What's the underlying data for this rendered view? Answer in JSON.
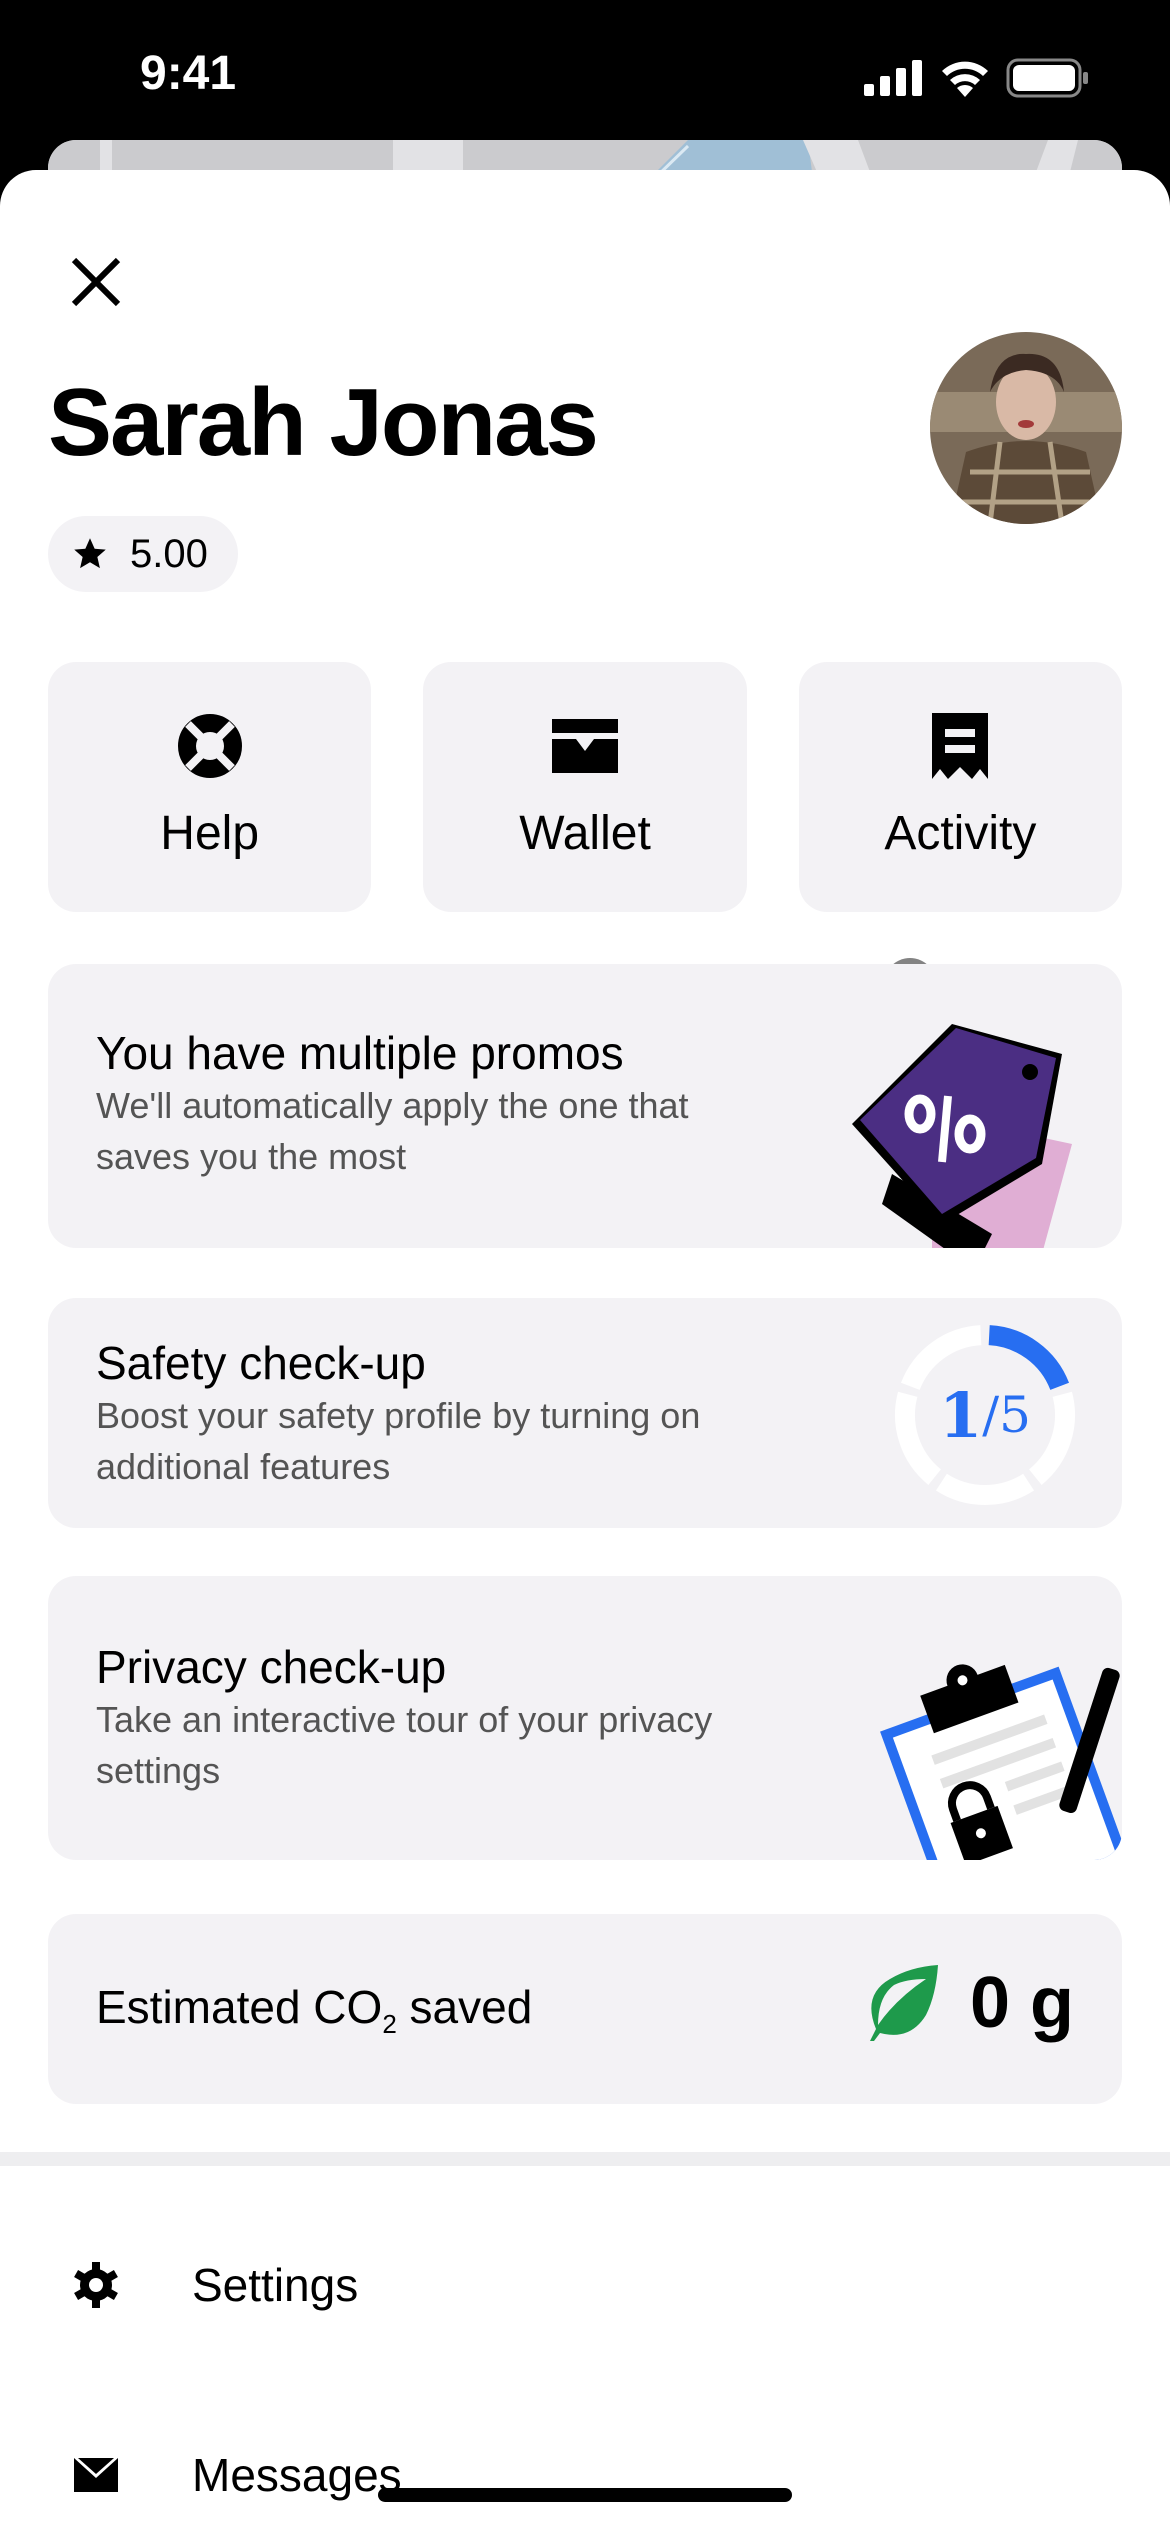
{
  "status_bar": {
    "time": "9:41"
  },
  "profile": {
    "name": "Sarah Jonas",
    "rating": "5.00",
    "avatar_alt": "Profile photo"
  },
  "quick_actions": [
    {
      "label": "Help",
      "icon": "lifebuoy-icon"
    },
    {
      "label": "Wallet",
      "icon": "wallet-icon"
    },
    {
      "label": "Activity",
      "icon": "receipt-icon"
    }
  ],
  "cards": {
    "promos": {
      "title": "You have multiple promos",
      "subtitle": "We'll automatically apply the one that saves you the most",
      "icon": "promo-tag-icon"
    },
    "safety": {
      "title": "Safety check-up",
      "subtitle": "Boost your safety profile by turning on additional features",
      "progress_completed": 1,
      "progress_total": 5,
      "progress_num": "1",
      "progress_den": "/5"
    },
    "privacy": {
      "title": "Privacy check-up",
      "subtitle": "Take an interactive tour of your privacy settings",
      "icon": "clipboard-lock-icon"
    },
    "co2": {
      "title_prefix": "Estimated CO",
      "title_sub": "2",
      "title_suffix": " saved",
      "value": "0 g",
      "icon": "leaf-icon"
    }
  },
  "menu": [
    {
      "label": "Settings",
      "icon": "gear-icon"
    },
    {
      "label": "Messages",
      "icon": "mail-icon"
    }
  ],
  "colors": {
    "accent_blue": "#276ef1",
    "leaf_green": "#1e9a4b",
    "promo_purple": "#4b2e83",
    "promo_pink": "#e0aed4",
    "card_bg": "#f3f2f5"
  }
}
